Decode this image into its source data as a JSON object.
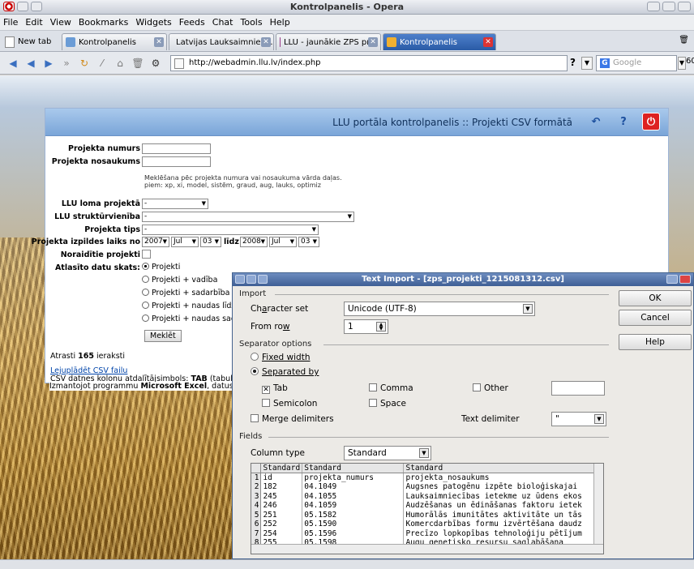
{
  "window": {
    "title": "Kontrolpanelis - Opera"
  },
  "menu": [
    "File",
    "Edit",
    "View",
    "Bookmarks",
    "Widgets",
    "Feeds",
    "Chat",
    "Tools",
    "Help"
  ],
  "tabs": {
    "new_tab": "New tab",
    "items": [
      {
        "label": "Kontrolpanelis",
        "fav": "#6b9cd6"
      },
      {
        "label": "Latvijas Lauksaimniec...",
        "fav": "#3c8a3c"
      },
      {
        "label": "LLU - jaunākie ZPS pr...",
        "fav": "#9a3c8a"
      },
      {
        "label": "Kontrolpanelis",
        "fav": "#f0b030",
        "active": true
      }
    ]
  },
  "toolbar": {
    "address": "http://webadmin.llu.lv/index.php",
    "search_placeholder": "Google",
    "help_mark": "?"
  },
  "panel": {
    "title": "LLU portāla kontrolpanelis :: Projekti CSV formātā",
    "labels": {
      "projekta_numurs": "Projekta numurs",
      "projekta_nosaukums": "Projekta nosaukums",
      "hint1": "Meklēšana pēc projekta numura vai nosaukuma vārda daļas.",
      "hint2": "piem: xp, xi, model, sistēm, graud, aug, lauks, optimiz",
      "llu_loma": "LLU loma projektā",
      "llu_struktur": "LLU struktūrvienība",
      "projekta_tips": "Projekta tips",
      "izpildes_laiks": "Projekta izpildes laiks no",
      "lidz": "līdz",
      "noraiditie": "Noraidītie projekti",
      "atlasito": "Atlasīto datu skats:"
    },
    "selects": {
      "loma": "-",
      "struktur": "-",
      "tips": "-",
      "y1": "2007",
      "m1": "Jul",
      "d1": "03",
      "y2": "2008",
      "m2": "Jul",
      "d2": "03"
    },
    "radios": [
      "Projekti",
      "Projekti + vadība",
      "Projekti + sadarbība",
      "Projekti + naudas līdzda",
      "Projekti + naudas sadal"
    ],
    "search_button": "Meklēt",
    "found": "Atrasti 165 ieraksti",
    "found_prefix": "Atrasti ",
    "found_count": "165",
    "found_suffix": " ieraksti",
    "download_link": "Lejuplādēt CSV failu",
    "csv_line1a": "CSV datnes kolonu atdalītājsimbols: ",
    "csv_line1b": "TAB",
    "csv_line1c": " (tabulators),",
    "csv_line2a": "Izmantojot programmu ",
    "csv_line2b": "Microsoft Excel",
    "csv_line2c": ", datus no CSV"
  },
  "dialog": {
    "title": "Text Import - [zps_projekti_1215081312.csv]",
    "import_section": "Import",
    "charset_label": "Character set",
    "charset_value": "Unicode (UTF-8)",
    "from_row_label": "From row",
    "from_row_value": "1",
    "separator_section": "Separator options",
    "fixed_width": "Fixed width",
    "separated_by": "Separated by",
    "tab": "Tab",
    "comma": "Comma",
    "other": "Other",
    "semicolon": "Semicolon",
    "space": "Space",
    "merge": "Merge delimiters",
    "text_delim_label": "Text delimiter",
    "text_delim_value": "\"",
    "fields_section": "Fields",
    "column_type_label": "Column type",
    "column_type_value": "Standard",
    "ok": "OK",
    "cancel": "Cancel",
    "help": "Help",
    "grid": {
      "header": [
        "Standard",
        "Standard",
        "Standard"
      ],
      "rows": [
        [
          "1",
          "id",
          "projekta_numurs",
          "projekta_nosaukums"
        ],
        [
          "2",
          "182",
          "04.1049",
          "Augsnes patogēnu izpēte bioloģiskajai"
        ],
        [
          "3",
          "245",
          "04.1055",
          "Lauksaimniecības ietekme uz ūdens ekos"
        ],
        [
          "4",
          "246",
          "04.1059",
          "Audzēšanas un ēdināšanas faktoru ietek"
        ],
        [
          "5",
          "251",
          "05.1582",
          "Humorālās imunitātes aktivitāte un tās"
        ],
        [
          "6",
          "252",
          "05.1590",
          "Komercdarbības formu izvērtēšana daudz"
        ],
        [
          "7",
          "254",
          "05.1596",
          "Precīzo lopkopības tehnoloģiju pētījum"
        ],
        [
          "8",
          "255",
          "05.1598",
          "Augu genetisko resursu saglabāšana"
        ]
      ]
    }
  }
}
